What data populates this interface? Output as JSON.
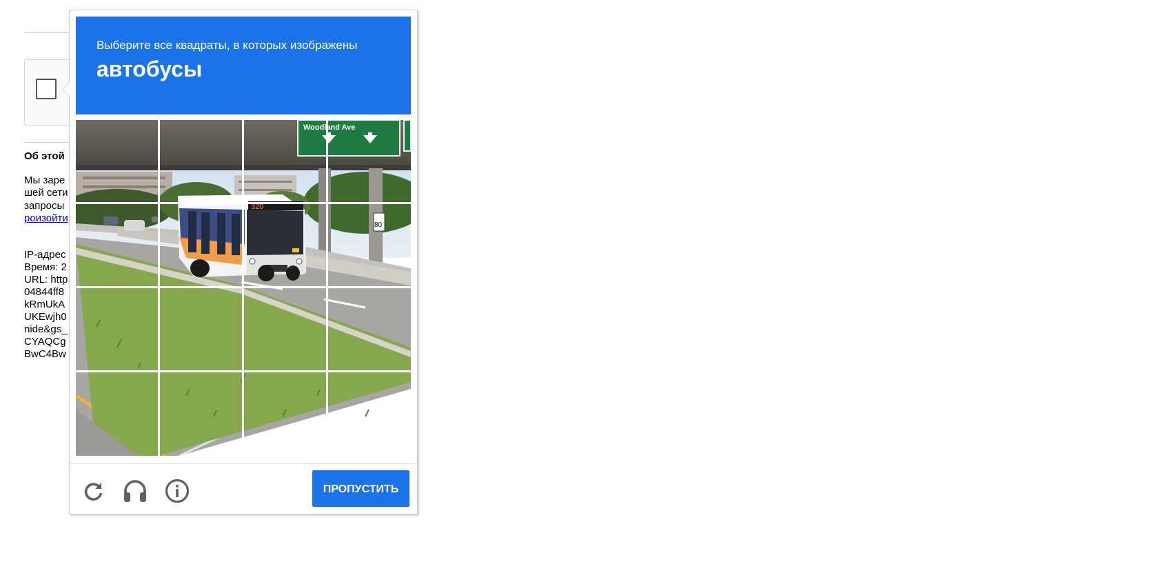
{
  "background_page": {
    "section_heading": "Об этой",
    "paragraph_lines": [
      "Мы заре",
      "шей сети",
      "запросы",
      "роизойти"
    ],
    "info_lines": [
      "IP-адрес",
      "Время: 2",
      "URL: http",
      "04844ff8",
      "kRmUkA",
      "UKEwjh0",
      "nide&gs_",
      "CYAQCg",
      "BwC4Bw"
    ]
  },
  "challenge": {
    "instruction": "Выберите все квадраты, в которых изображены",
    "target": "автобусы",
    "grid": {
      "rows": 4,
      "cols": 4
    },
    "scene_text": {
      "sign_place": "Woodland Ave",
      "bus_number": "320",
      "speed_sign": "80"
    },
    "footer": {
      "reload_icon": "reload-icon",
      "audio_icon": "headphones-icon",
      "info_icon": "info-icon",
      "skip_label": "ПРОПУСТИТЬ"
    },
    "colors": {
      "header": "#1a73e8",
      "button": "#1a73e8",
      "icons": "#616161"
    }
  }
}
